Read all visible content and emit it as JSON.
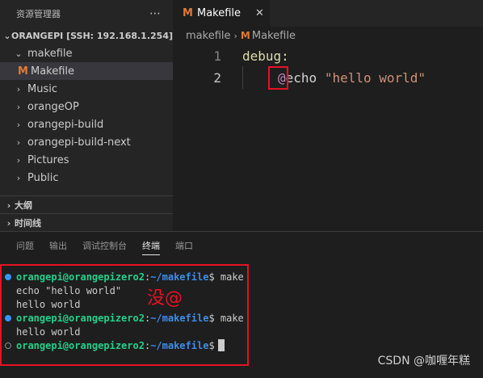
{
  "sidebar": {
    "title": "资源管理器",
    "more_icon": "⋯",
    "workspace": "ORANGEPI [SSH: 192.168.1.254]",
    "tree": [
      {
        "label": "makefile",
        "chev": "⌄"
      },
      {
        "label": "Makefile",
        "icon": "M"
      },
      {
        "label": "Music",
        "chev": "›"
      },
      {
        "label": "orangeOP",
        "chev": "›"
      },
      {
        "label": "orangepi-build",
        "chev": "›"
      },
      {
        "label": "orangepi-build-next",
        "chev": "›"
      },
      {
        "label": "Pictures",
        "chev": "›"
      },
      {
        "label": "Public",
        "chev": "›"
      }
    ],
    "outline": "大纲",
    "timeline": "时间线"
  },
  "editor": {
    "tab_label": "Makefile",
    "tab_icon": "M",
    "close": "✕",
    "breadcrumb": {
      "folder": "makefile",
      "sep": "›",
      "file": "Makefile"
    },
    "lines": [
      {
        "num": "1",
        "label": "debug:"
      },
      {
        "num": "2",
        "at": "@",
        "cmd": "echo ",
        "str": "\"hello world\""
      }
    ]
  },
  "panel": {
    "tabs": [
      "问题",
      "输出",
      "调试控制台",
      "终端",
      "端口"
    ],
    "active_tab": "终端",
    "terminal": [
      {
        "user": "orangepi@orangepizero2",
        "colon": ":",
        "path": "~/makefile",
        "cmd": "$ make"
      },
      {
        "text": "echo \"hello world\""
      },
      {
        "text": "hello world"
      },
      {
        "user": "orangepi@orangepizero2",
        "colon": ":",
        "path": "~/makefile",
        "cmd": "$ make"
      },
      {
        "text": "hello world"
      },
      {
        "user": "orangepi@orangepizero2",
        "colon": ":",
        "path": "~/makefile",
        "cmd": "$"
      }
    ],
    "annotation": "没@"
  },
  "watermark": "CSDN @咖喱年糕"
}
